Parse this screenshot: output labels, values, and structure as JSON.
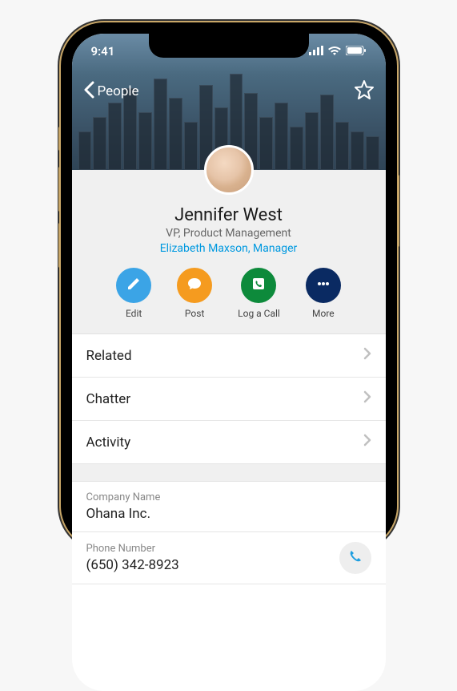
{
  "status": {
    "time": "9:41"
  },
  "nav": {
    "back_label": "People"
  },
  "profile": {
    "name": "Jennifer West",
    "title": "VP, Product Management",
    "manager": "Elizabeth Maxson, Manager"
  },
  "actions": {
    "edit": {
      "label": "Edit",
      "color": "#3ba4e6"
    },
    "post": {
      "label": "Post",
      "color": "#f59b1f"
    },
    "call": {
      "label": "Log a Call",
      "color": "#0d8a3b"
    },
    "more": {
      "label": "More",
      "color": "#0a2a62"
    }
  },
  "tabs": {
    "related": "Related",
    "chatter": "Chatter",
    "activity": "Activity"
  },
  "fields": {
    "company": {
      "label": "Company Name",
      "value": "Ohana Inc."
    },
    "phone": {
      "label": "Phone Number",
      "value": "(650) 342-8923"
    }
  }
}
